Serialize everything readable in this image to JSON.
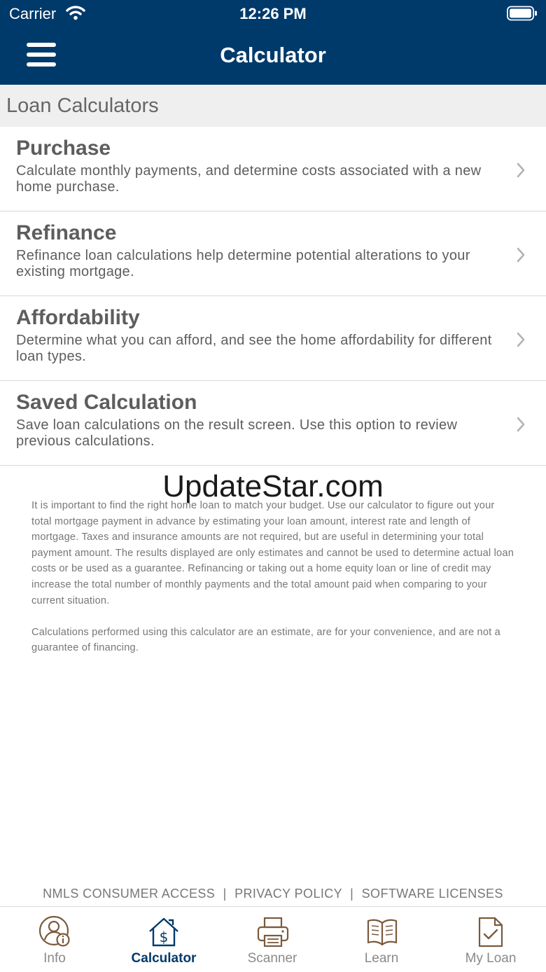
{
  "status_bar": {
    "carrier": "Carrier",
    "time": "12:26 PM"
  },
  "header": {
    "title": "Calculator",
    "menu_icon": "hamburger-menu-icon"
  },
  "section": {
    "title": "Loan Calculators"
  },
  "items": [
    {
      "title": "Purchase",
      "description": "Calculate monthly payments, and determine costs associated with a new home purchase."
    },
    {
      "title": "Refinance",
      "description": "Refinance loan calculations help determine potential alterations to your existing mortgage."
    },
    {
      "title": "Affordability",
      "description": "Determine what you can afford, and see the home affordability for different loan types."
    },
    {
      "title": "Saved Calculation",
      "description": "Save loan calculations on the result screen. Use this option to review previous calculations."
    }
  ],
  "watermark": "UpdateStar.com",
  "disclaimer": {
    "p1": "It is important to find the right home loan to match your budget. Use our calculator to figure out your total mortgage payment in advance by estimating your loan amount, interest rate and length of mortgage. Taxes and insurance amounts are not required, but are useful in determining your total payment amount. The results displayed are only estimates and cannot be used to determine actual loan costs or be used as a guarantee. Refinancing or taking out a home equity loan or line of credit may increase the total number of monthly payments and the total amount paid when comparing to your current situation.",
    "p2": "Calculations performed using this calculator are an estimate, are for your convenience, and are not a guarantee of financing."
  },
  "footer_links": {
    "nmls": "NMLS CONSUMER ACCESS",
    "privacy": "PRIVACY POLICY",
    "licenses": "SOFTWARE LICENSES",
    "separator": "|"
  },
  "tabs": [
    {
      "label": "Info",
      "icon": "person-info-icon",
      "active": false
    },
    {
      "label": "Calculator",
      "icon": "house-dollar-icon",
      "active": true
    },
    {
      "label": "Scanner",
      "icon": "printer-icon",
      "active": false
    },
    {
      "label": "Learn",
      "icon": "open-book-icon",
      "active": false
    },
    {
      "label": "My Loan",
      "icon": "document-check-icon",
      "active": false
    }
  ],
  "colors": {
    "primary": "#003a6b",
    "section_bg": "#efefef",
    "tab_icon": "#7a5a3c",
    "text_gray": "#5d5d5d"
  }
}
